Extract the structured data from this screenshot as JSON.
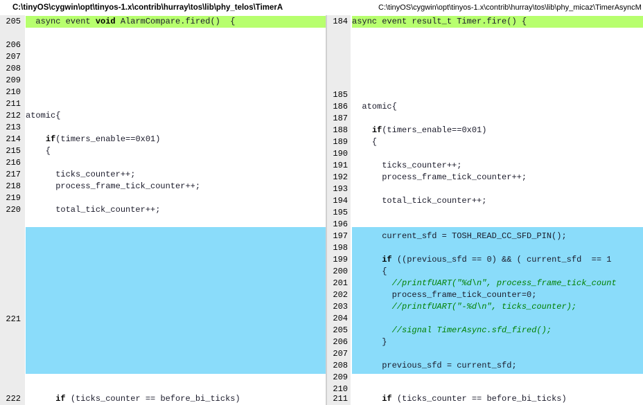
{
  "left_panel": {
    "title": "C:\\tinyOS\\cygwin\\opt\\tinyos-1.x\\contrib\\hurray\\tos\\lib\\phy_telos\\TimerA",
    "lines": [
      {
        "num": "205",
        "segs": [
          {
            "t": "  async event ",
            "c": "n"
          },
          {
            "t": "void",
            "c": "kw"
          },
          {
            "t": " AlarmCompare.fired()  {",
            "c": "n"
          }
        ]
      },
      {
        "num": "206",
        "segs": []
      },
      {
        "num": "207",
        "segs": []
      },
      {
        "num": "208",
        "segs": []
      },
      {
        "num": "209",
        "segs": []
      },
      {
        "num": "210",
        "segs": []
      },
      {
        "num": "211",
        "segs": []
      },
      {
        "num": "212",
        "segs": [
          {
            "t": "atomic{",
            "c": "n"
          }
        ]
      },
      {
        "num": "213",
        "segs": []
      },
      {
        "num": "214",
        "segs": [
          {
            "t": "    ",
            "c": "n"
          },
          {
            "t": "if",
            "c": "kw"
          },
          {
            "t": "(timers_enable==0x01)",
            "c": "n"
          }
        ]
      },
      {
        "num": "215",
        "segs": [
          {
            "t": "    {",
            "c": "n"
          }
        ]
      },
      {
        "num": "216",
        "segs": []
      },
      {
        "num": "217",
        "segs": [
          {
            "t": "      ticks_counter++;",
            "c": "n"
          }
        ]
      },
      {
        "num": "218",
        "segs": [
          {
            "t": "      process_frame_tick_counter++;",
            "c": "n"
          }
        ]
      },
      {
        "num": "219",
        "segs": []
      },
      {
        "num": "220",
        "segs": [
          {
            "t": "      total_tick_counter++;",
            "c": "n"
          }
        ]
      },
      {
        "num": "221",
        "segs": []
      },
      {
        "num": "222",
        "segs": [
          {
            "t": "      ",
            "c": "n"
          },
          {
            "t": "if",
            "c": "kw"
          },
          {
            "t": " (ticks_counter == before_bi_ticks)",
            "c": "n"
          }
        ]
      }
    ]
  },
  "right_panel": {
    "title": "C:\\tinyOS\\cygwin\\opt\\tinyos-1.x\\contrib\\hurray\\tos\\lib\\phy_micaz\\TimerAsyncM",
    "lines": [
      {
        "num": "184",
        "segs": [
          {
            "t": "async event result_t Timer.fire() {",
            "c": "n"
          }
        ]
      },
      {
        "num": "185",
        "segs": []
      },
      {
        "num": "186",
        "segs": [
          {
            "t": "  atomic{",
            "c": "n"
          }
        ]
      },
      {
        "num": "187",
        "segs": []
      },
      {
        "num": "188",
        "segs": [
          {
            "t": "    ",
            "c": "n"
          },
          {
            "t": "if",
            "c": "kw"
          },
          {
            "t": "(timers_enable==0x01)",
            "c": "n"
          }
        ]
      },
      {
        "num": "189",
        "segs": [
          {
            "t": "    {",
            "c": "n"
          }
        ]
      },
      {
        "num": "190",
        "segs": []
      },
      {
        "num": "191",
        "segs": [
          {
            "t": "      ticks_counter++;",
            "c": "n"
          }
        ]
      },
      {
        "num": "192",
        "segs": [
          {
            "t": "      process_frame_tick_counter++;",
            "c": "n"
          }
        ]
      },
      {
        "num": "193",
        "segs": []
      },
      {
        "num": "194",
        "segs": [
          {
            "t": "      total_tick_counter++;",
            "c": "n"
          }
        ]
      },
      {
        "num": "195",
        "segs": []
      },
      {
        "num": "196",
        "segs": []
      },
      {
        "num": "197",
        "segs": [
          {
            "t": "      current_sfd = TOSH_READ_CC_SFD_PIN();",
            "c": "n"
          }
        ]
      },
      {
        "num": "198",
        "segs": []
      },
      {
        "num": "199",
        "segs": [
          {
            "t": "      ",
            "c": "n"
          },
          {
            "t": "if",
            "c": "kw"
          },
          {
            "t": " ((previous_sfd == 0) && ( current_sfd  == 1",
            "c": "n"
          }
        ]
      },
      {
        "num": "200",
        "segs": [
          {
            "t": "      {",
            "c": "n"
          }
        ]
      },
      {
        "num": "201",
        "segs": [
          {
            "t": "        ",
            "c": "n"
          },
          {
            "t": "//printfUART(\"%d\\n\", process_frame_tick_count",
            "c": "cm"
          }
        ]
      },
      {
        "num": "202",
        "segs": [
          {
            "t": "        process_frame_tick_counter=0;",
            "c": "n"
          }
        ]
      },
      {
        "num": "203",
        "segs": [
          {
            "t": "        ",
            "c": "n"
          },
          {
            "t": "//printfUART(\"-%d\\n\", ticks_counter);",
            "c": "cm"
          }
        ]
      },
      {
        "num": "204",
        "segs": []
      },
      {
        "num": "205",
        "segs": [
          {
            "t": "        ",
            "c": "n"
          },
          {
            "t": "//signal TimerAsync.sfd_fired();",
            "c": "cm"
          }
        ]
      },
      {
        "num": "206",
        "segs": [
          {
            "t": "      }",
            "c": "n"
          }
        ]
      },
      {
        "num": "207",
        "segs": []
      },
      {
        "num": "208",
        "segs": [
          {
            "t": "      previous_sfd = current_sfd;",
            "c": "n"
          }
        ]
      },
      {
        "num": "209",
        "segs": []
      },
      {
        "num": "210",
        "segs": []
      },
      {
        "num": "211",
        "segs": [
          {
            "t": "      ",
            "c": "n"
          },
          {
            "t": "if",
            "c": "kw"
          },
          {
            "t": " (ticks_counter == before_bi_ticks)",
            "c": "n"
          }
        ]
      }
    ]
  },
  "colors": {
    "changed_line": "#b7ff6e",
    "inserted_block": "#8adcfa",
    "gutter": "#ececec",
    "keyword": "#000000",
    "comment": "#008000"
  }
}
